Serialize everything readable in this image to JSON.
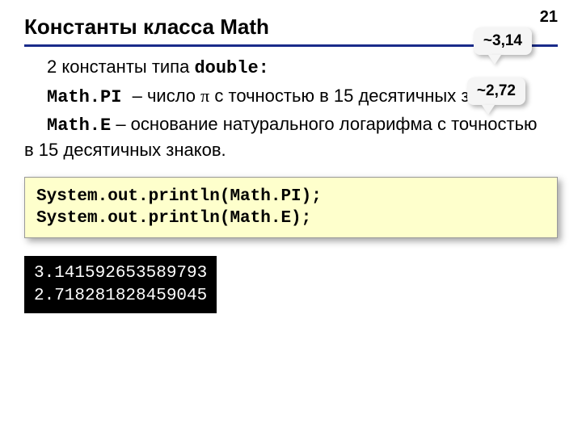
{
  "page_number": "21",
  "title": "Константы класса Math",
  "callouts": {
    "pi": "~3,14",
    "e": "~2,72"
  },
  "text": {
    "intro_prefix": "2 константы типа ",
    "intro_code": "double:",
    "pi_const": "Math.PI ",
    "pi_desc_dash": " – число ",
    "pi_symbol": "π",
    "pi_desc_rest": " с точностью в 15 десятичных знаков.",
    "e_const": "Math.E",
    "e_desc_dash": " – основание натурального логарифма с точностью в 15 десятичных знаков."
  },
  "code": "System.out.println(Math.PI);\nSystem.out.println(Math.E);",
  "output": "3.141592653589793\n2.718281828459045"
}
